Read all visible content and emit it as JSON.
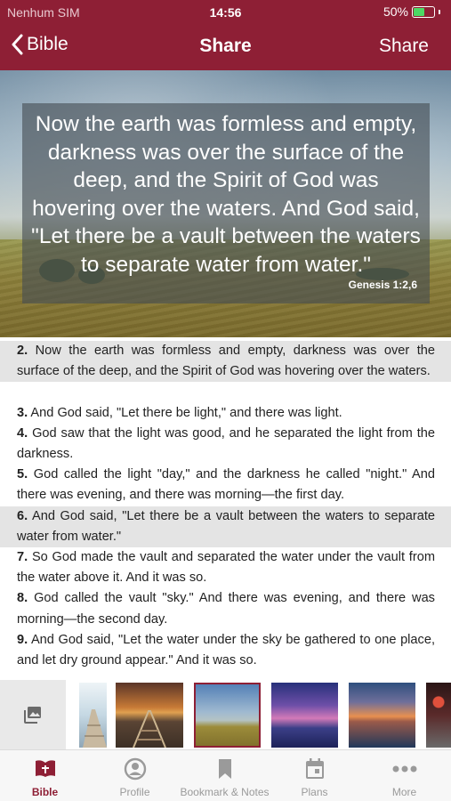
{
  "status": {
    "carrier": "Nenhum SIM",
    "time": "14:56",
    "battery": "50%"
  },
  "nav": {
    "back_label": "Bible",
    "title": "Share",
    "action_label": "Share"
  },
  "quote": {
    "text": "Now the earth was formless and empty, darkness was over the surface of the deep, and the Spirit of God was hovering over the waters. And God said, \"Let there be a vault between the waters to separate water from water.\"",
    "reference": "Genesis 1:2,6"
  },
  "verses": [
    {
      "num": "2.",
      "text": "Now the earth was formless and empty, darkness was over the surface of the deep, and the Spirit of God was hovering over the waters.",
      "highlighted": true
    },
    {
      "num": "3.",
      "text": "And God said, \"Let there be light,\" and there was light.",
      "highlighted": false
    },
    {
      "num": "4.",
      "text": "God saw that the light was good, and he separated the light from the darkness.",
      "highlighted": false
    },
    {
      "num": "5.",
      "text": "God called the light \"day,\" and the darkness he called \"night.\" And there was evening, and there was morning—the first day.",
      "highlighted": false
    },
    {
      "num": "6.",
      "text": "And God said, \"Let there be a vault between the waters to separate water from water.\"",
      "highlighted": true
    },
    {
      "num": "7.",
      "text": "So God made the vault and separated the water under the vault from the water above it. And it was so.",
      "highlighted": false
    },
    {
      "num": "8.",
      "text": "God called the vault \"sky.\" And there was evening, and there was morning—the second day.",
      "highlighted": false
    },
    {
      "num": "9.",
      "text": "And God said, \"Let the water under the sky be gathered to one place, and let dry ground appear.\" And it was so.",
      "highlighted": false
    }
  ],
  "thumbnails": [
    {
      "icon": "pier-image",
      "colors": [
        "#e9f2f6",
        "#b7cfdc",
        "#8aa5b8"
      ]
    },
    {
      "icon": "railroad-sunset-image",
      "colors": [
        "#6a3a2a",
        "#d48a3c",
        "#4a3a2c"
      ]
    },
    {
      "icon": "field-image",
      "colors": [
        "#5e86b8",
        "#b2c7d6",
        "#9a8a3a"
      ],
      "selected": true
    },
    {
      "icon": "purple-sunset-image",
      "colors": [
        "#3a3fa0",
        "#c66fb5",
        "#2a2f6a"
      ]
    },
    {
      "icon": "lake-sunset-image",
      "colors": [
        "#335a8a",
        "#e89050",
        "#203a5a"
      ]
    },
    {
      "icon": "red-lights-image",
      "colors": [
        "#3a1a1a",
        "#d04a3a",
        "#555555"
      ]
    }
  ],
  "tabs": [
    {
      "label": "Bible",
      "icon": "bible-icon",
      "active": true
    },
    {
      "label": "Profile",
      "icon": "profile-icon",
      "active": false
    },
    {
      "label": "Bookmark & Notes",
      "icon": "bookmark-icon",
      "active": false
    },
    {
      "label": "Plans",
      "icon": "calendar-icon",
      "active": false
    },
    {
      "label": "More",
      "icon": "more-icon",
      "active": false
    }
  ],
  "colors": {
    "accent": "#8e1f35",
    "highlight": "#e4e4e4",
    "tab_inactive": "#9a9a9a"
  }
}
